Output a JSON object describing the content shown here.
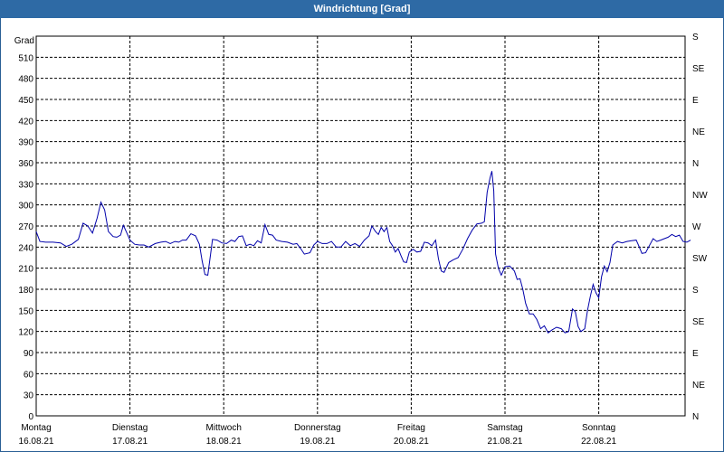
{
  "window": {
    "title": "Windrichtung [Grad]"
  },
  "chart_data": {
    "type": "line",
    "title": "Windrichtung [Grad]",
    "ylabel": "Grad",
    "ylim": [
      0,
      540
    ],
    "yticks": [
      0,
      30,
      60,
      90,
      120,
      150,
      180,
      210,
      240,
      270,
      300,
      330,
      360,
      390,
      420,
      450,
      480,
      510
    ],
    "right_axis_labels": [
      "N",
      "NE",
      "E",
      "SE",
      "S",
      "SW",
      "W",
      "NW",
      "N",
      "NE",
      "E",
      "SE",
      "S"
    ],
    "x_day_labels": [
      {
        "day": "Montag",
        "date": "16.08.21"
      },
      {
        "day": "Dienstag",
        "date": "17.08.21"
      },
      {
        "day": "Mittwoch",
        "date": "18.08.21"
      },
      {
        "day": "Donnerstag",
        "date": "19.08.21"
      },
      {
        "day": "Freitag",
        "date": "20.08.21"
      },
      {
        "day": "Samstag",
        "date": "21.08.21"
      },
      {
        "day": "Sonntag",
        "date": "22.08.21"
      }
    ],
    "xlim_days": [
      0,
      7
    ],
    "grid": true,
    "series": [
      {
        "color": "#0000aa",
        "points": [
          [
            0.0,
            262
          ],
          [
            0.04,
            248
          ],
          [
            0.1,
            247
          ],
          [
            0.18,
            247
          ],
          [
            0.26,
            246
          ],
          [
            0.32,
            241
          ],
          [
            0.38,
            244
          ],
          [
            0.45,
            251
          ],
          [
            0.5,
            274
          ],
          [
            0.55,
            270
          ],
          [
            0.6,
            260
          ],
          [
            0.65,
            281
          ],
          [
            0.69,
            304
          ],
          [
            0.73,
            293
          ],
          [
            0.77,
            262
          ],
          [
            0.82,
            255
          ],
          [
            0.86,
            254
          ],
          [
            0.9,
            257
          ],
          [
            0.93,
            271
          ],
          [
            0.96,
            262
          ],
          [
            1.0,
            250
          ],
          [
            1.05,
            244
          ],
          [
            1.1,
            243
          ],
          [
            1.15,
            243
          ],
          [
            1.2,
            240
          ],
          [
            1.27,
            245
          ],
          [
            1.33,
            247
          ],
          [
            1.38,
            248
          ],
          [
            1.43,
            245
          ],
          [
            1.48,
            248
          ],
          [
            1.52,
            247
          ],
          [
            1.56,
            250
          ],
          [
            1.6,
            250
          ],
          [
            1.65,
            259
          ],
          [
            1.7,
            256
          ],
          [
            1.74,
            244
          ],
          [
            1.77,
            220
          ],
          [
            1.8,
            201
          ],
          [
            1.83,
            200
          ],
          [
            1.86,
            230
          ],
          [
            1.88,
            251
          ],
          [
            1.93,
            250
          ],
          [
            1.98,
            246
          ],
          [
            2.03,
            245
          ],
          [
            2.08,
            250
          ],
          [
            2.12,
            248
          ],
          [
            2.16,
            255
          ],
          [
            2.2,
            256
          ],
          [
            2.24,
            242
          ],
          [
            2.28,
            244
          ],
          [
            2.32,
            242
          ],
          [
            2.36,
            249
          ],
          [
            2.4,
            246
          ],
          [
            2.44,
            272
          ],
          [
            2.48,
            258
          ],
          [
            2.52,
            257
          ],
          [
            2.56,
            250
          ],
          [
            2.62,
            248
          ],
          [
            2.68,
            247
          ],
          [
            2.74,
            244
          ],
          [
            2.78,
            245
          ],
          [
            2.82,
            238
          ],
          [
            2.86,
            230
          ],
          [
            2.92,
            232
          ],
          [
            2.96,
            243
          ],
          [
            3.0,
            248
          ],
          [
            3.05,
            245
          ],
          [
            3.1,
            245
          ],
          [
            3.15,
            248
          ],
          [
            3.2,
            240
          ],
          [
            3.25,
            240
          ],
          [
            3.3,
            248
          ],
          [
            3.35,
            242
          ],
          [
            3.4,
            245
          ],
          [
            3.45,
            241
          ],
          [
            3.5,
            250
          ],
          [
            3.55,
            256
          ],
          [
            3.58,
            270
          ],
          [
            3.62,
            262
          ],
          [
            3.65,
            258
          ],
          [
            3.68,
            268
          ],
          [
            3.71,
            262
          ],
          [
            3.74,
            268
          ],
          [
            3.77,
            248
          ],
          [
            3.8,
            242
          ],
          [
            3.83,
            233
          ],
          [
            3.86,
            238
          ],
          [
            3.89,
            228
          ],
          [
            3.92,
            219
          ],
          [
            3.95,
            218
          ],
          [
            3.98,
            233
          ],
          [
            4.02,
            237
          ],
          [
            4.06,
            233
          ],
          [
            4.1,
            234
          ],
          [
            4.14,
            247
          ],
          [
            4.18,
            246
          ],
          [
            4.22,
            242
          ],
          [
            4.26,
            250
          ],
          [
            4.29,
            224
          ],
          [
            4.32,
            206
          ],
          [
            4.35,
            204
          ],
          [
            4.4,
            218
          ],
          [
            4.45,
            222
          ],
          [
            4.5,
            225
          ],
          [
            4.55,
            237
          ],
          [
            4.6,
            252
          ],
          [
            4.65,
            264
          ],
          [
            4.7,
            273
          ],
          [
            4.75,
            274
          ],
          [
            4.78,
            276
          ],
          [
            4.81,
            318
          ],
          [
            4.84,
            338
          ],
          [
            4.86,
            348
          ],
          [
            4.88,
            320
          ],
          [
            4.9,
            230
          ],
          [
            4.93,
            210
          ],
          [
            4.96,
            200
          ],
          [
            5.0,
            212
          ],
          [
            5.05,
            213
          ],
          [
            5.1,
            206
          ],
          [
            5.13,
            194
          ],
          [
            5.16,
            195
          ],
          [
            5.19,
            180
          ],
          [
            5.22,
            160
          ],
          [
            5.26,
            145
          ],
          [
            5.3,
            145
          ],
          [
            5.34,
            137
          ],
          [
            5.38,
            124
          ],
          [
            5.42,
            128
          ],
          [
            5.46,
            118
          ],
          [
            5.5,
            122
          ],
          [
            5.55,
            126
          ],
          [
            5.6,
            124
          ],
          [
            5.64,
            118
          ],
          [
            5.68,
            120
          ],
          [
            5.72,
            152
          ],
          [
            5.75,
            148
          ],
          [
            5.78,
            127
          ],
          [
            5.81,
            120
          ],
          [
            5.85,
            124
          ],
          [
            5.88,
            150
          ],
          [
            5.91,
            170
          ],
          [
            5.94,
            187
          ],
          [
            5.97,
            175
          ],
          [
            6.0,
            168
          ],
          [
            6.03,
            198
          ],
          [
            6.06,
            213
          ],
          [
            6.09,
            205
          ],
          [
            6.12,
            218
          ],
          [
            6.15,
            243
          ],
          [
            6.2,
            248
          ],
          [
            6.25,
            246
          ],
          [
            6.3,
            248
          ],
          [
            6.35,
            249
          ],
          [
            6.4,
            250
          ],
          [
            6.43,
            241
          ],
          [
            6.46,
            231
          ],
          [
            6.5,
            232
          ],
          [
            6.54,
            242
          ],
          [
            6.58,
            252
          ],
          [
            6.62,
            248
          ],
          [
            6.66,
            250
          ],
          [
            6.7,
            252
          ],
          [
            6.74,
            254
          ],
          [
            6.78,
            258
          ],
          [
            6.82,
            255
          ],
          [
            6.86,
            257
          ],
          [
            6.9,
            248
          ],
          [
            6.94,
            247
          ],
          [
            6.98,
            250
          ]
        ]
      }
    ]
  }
}
